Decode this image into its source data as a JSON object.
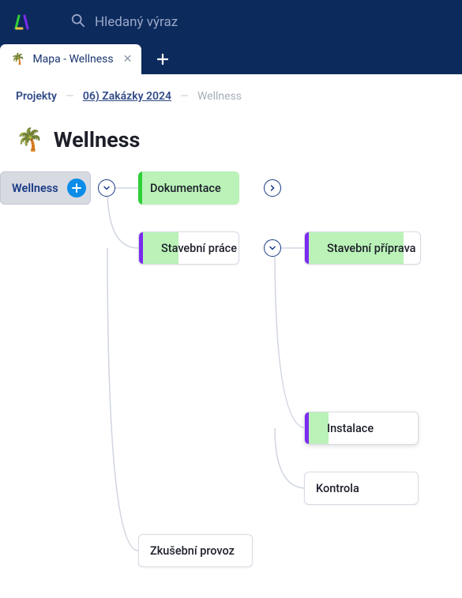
{
  "header": {
    "search_placeholder": "Hledaný výraz"
  },
  "tabs": {
    "active": {
      "emoji": "🌴",
      "label": "Mapa - Wellness"
    }
  },
  "breadcrumb": {
    "projects": "Projekty",
    "mid": "06) Zakázky 2024",
    "current": "Wellness"
  },
  "page": {
    "emoji": "🌴",
    "title": "Wellness"
  },
  "nodes": {
    "root": "Wellness",
    "doc": "Dokumentace",
    "build": "Stavební práce",
    "prep": "Stavební příprava",
    "install": "Instalace",
    "check": "Kontrola",
    "trial": "Zkušební provoz"
  },
  "colors": {
    "header_bg": "#0d2a5c",
    "accent_blue": "#0c8ce9",
    "fill_green": "#baf2b7",
    "stripe_green": "#2fcf37",
    "stripe_purple": "#7b2cf0"
  }
}
